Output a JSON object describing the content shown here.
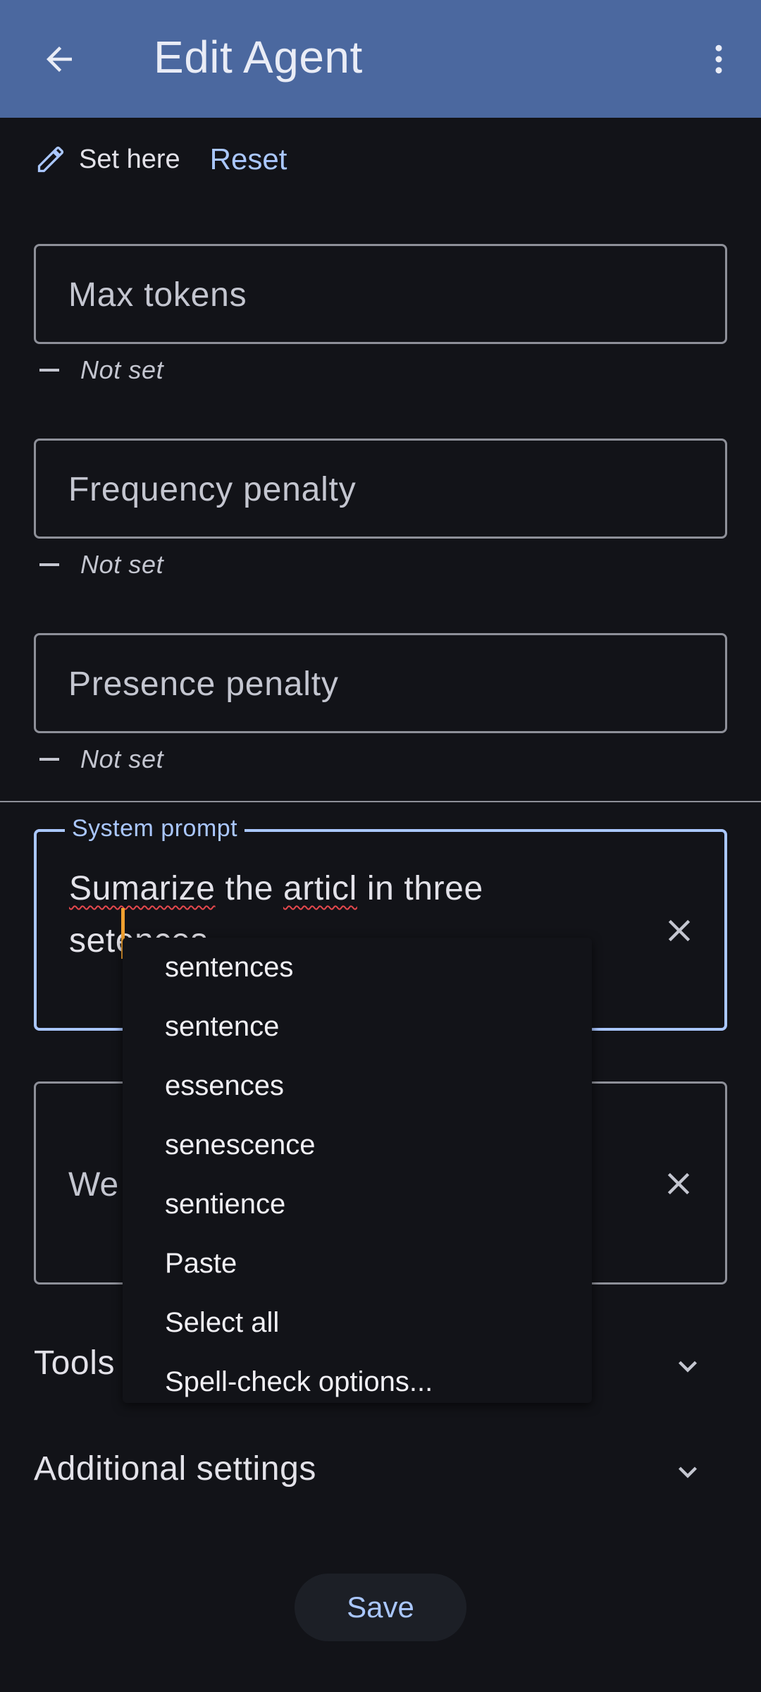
{
  "appbar": {
    "title": "Edit Agent",
    "back_icon": "arrow-back-icon",
    "more_icon": "more-vert-icon",
    "background": "#4b689f"
  },
  "set_row": {
    "label": "Set here",
    "reset_label": "Reset",
    "icon": "pencil-icon"
  },
  "fields": {
    "max_tokens": {
      "placeholder": "Max tokens",
      "hint": "Not set"
    },
    "frequency_penalty": {
      "placeholder": "Frequency penalty",
      "hint": "Not set"
    },
    "presence_penalty": {
      "placeholder": "Presence penalty",
      "hint": "Not set"
    }
  },
  "system_prompt": {
    "label": "System prompt",
    "word1": "Sumarize",
    "text_mid": " the ",
    "word2": "articl",
    "text_end": " in three",
    "line2": "setences",
    "accent": "#aac7ff"
  },
  "second_field": {
    "visible_text": "We"
  },
  "sections": {
    "tools": "Tools",
    "additional_settings": "Additional settings"
  },
  "save_label": "Save",
  "spell_menu": {
    "items": [
      "sentences",
      "sentence",
      "essences",
      "senescence",
      "sentience",
      "Paste",
      "Select all",
      "Spell-check options..."
    ]
  }
}
